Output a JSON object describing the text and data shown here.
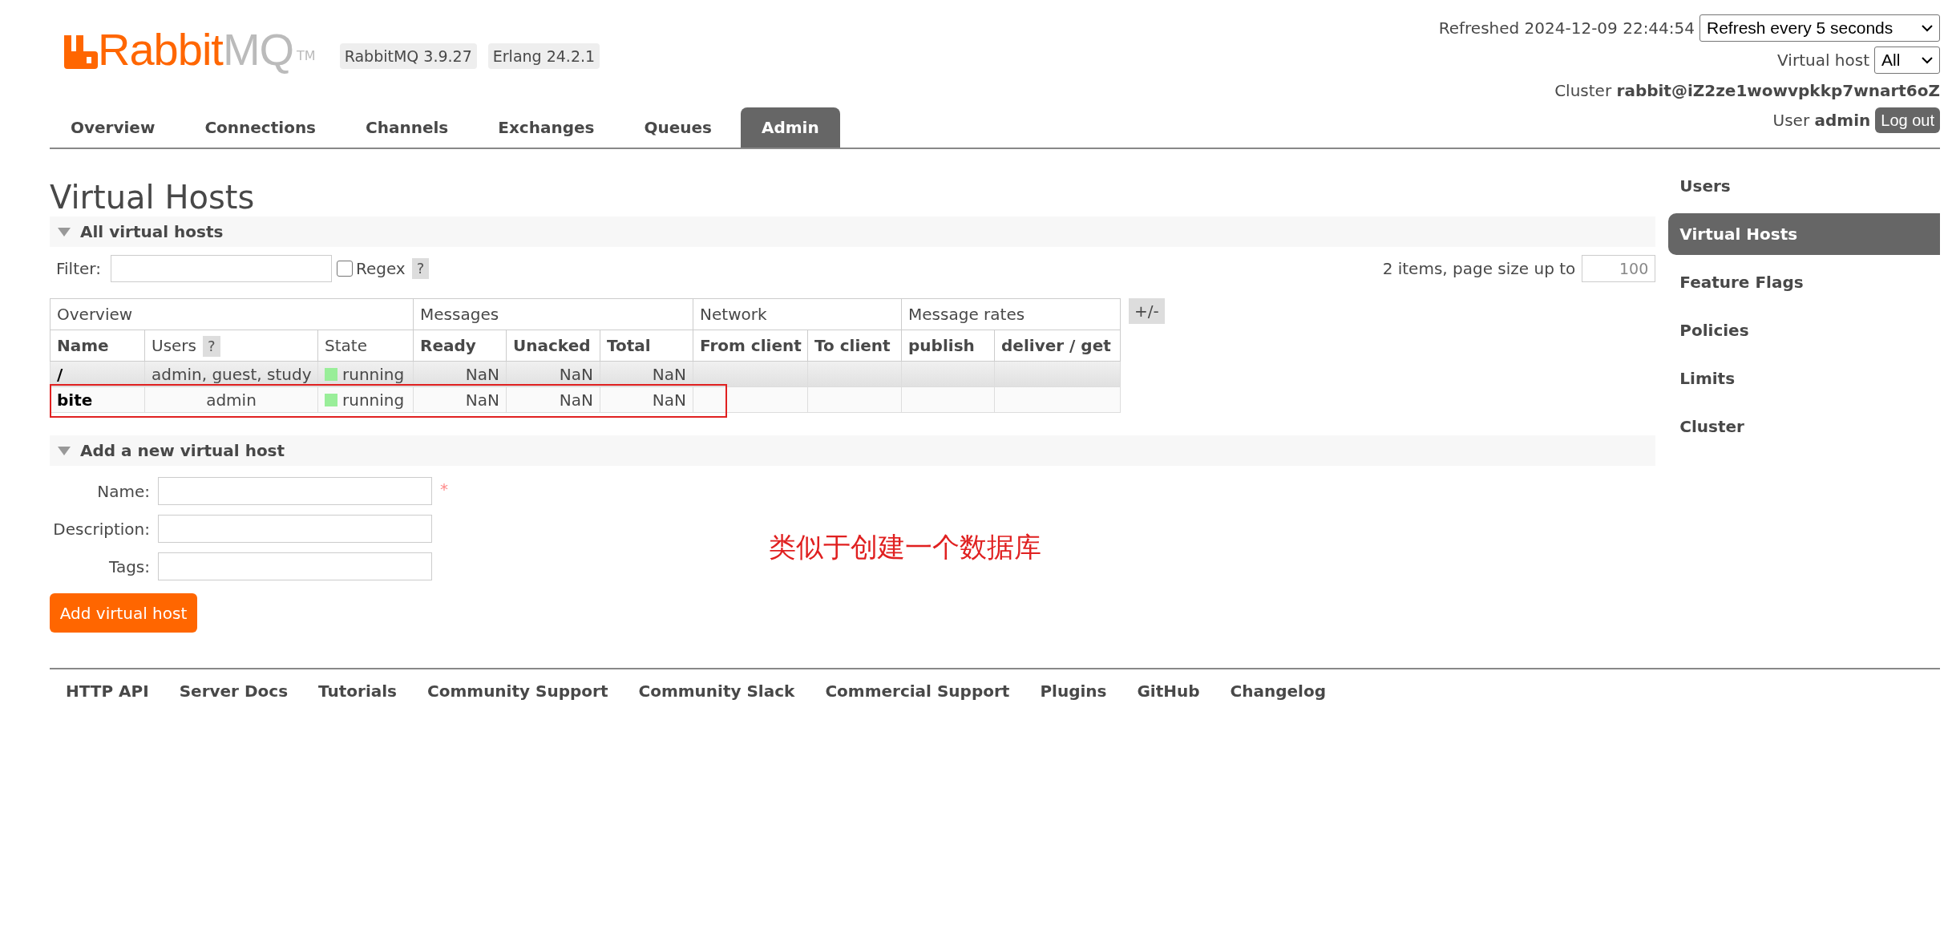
{
  "logo": {
    "brand_main": "Rabbit",
    "brand_accent": "MQ",
    "trademark": "TM"
  },
  "versions": [
    "RabbitMQ 3.9.27",
    "Erlang 24.2.1"
  ],
  "tabs": [
    {
      "label": "Overview",
      "selected": false
    },
    {
      "label": "Connections",
      "selected": false
    },
    {
      "label": "Channels",
      "selected": false
    },
    {
      "label": "Exchanges",
      "selected": false
    },
    {
      "label": "Queues",
      "selected": false
    },
    {
      "label": "Admin",
      "selected": true
    }
  ],
  "status": {
    "refreshed_label": "Refreshed 2024-12-09 22:44:54",
    "refresh_select": "Refresh every 5 seconds",
    "vhost_label": "Virtual host",
    "vhost_select": "All",
    "cluster_label": "Cluster",
    "cluster_name": "rabbit@iZ2ze1wowvpkkp7wnart6oZ",
    "user_label": "User",
    "user_name": "admin",
    "logout": "Log out"
  },
  "page_title": "Virtual Hosts",
  "all_section": {
    "title": "All virtual hosts",
    "filter_label": "Filter:",
    "regex_label": "Regex",
    "regex_checked": false,
    "help": "?",
    "count_text": "2 items, page size up to",
    "page_size": "100"
  },
  "table": {
    "groups": [
      {
        "label": "Overview"
      },
      {
        "label": "Messages"
      },
      {
        "label": "Network"
      },
      {
        "label": "Message rates"
      }
    ],
    "columns": [
      {
        "label": "Name",
        "help": false
      },
      {
        "label": "Users",
        "help": true
      },
      {
        "label": "State",
        "help": false
      },
      {
        "label": "Ready",
        "help": false
      },
      {
        "label": "Unacked",
        "help": false
      },
      {
        "label": "Total",
        "help": false
      },
      {
        "label": "From client",
        "help": false
      },
      {
        "label": "To client",
        "help": false
      },
      {
        "label": "publish",
        "help": false
      },
      {
        "label": "deliver / get",
        "help": false
      }
    ],
    "help": "?",
    "toggle": "+/-",
    "rows": [
      {
        "name": "/",
        "users": "admin, guest, study",
        "state": "running",
        "ready": "NaN",
        "unacked": "NaN",
        "total": "NaN",
        "highlighted": false
      },
      {
        "name": "bite",
        "users": "admin",
        "state": "running",
        "ready": "NaN",
        "unacked": "NaN",
        "total": "NaN",
        "highlighted": true
      }
    ]
  },
  "add_section": {
    "title": "Add a new virtual host",
    "fields": [
      {
        "label": "Name:",
        "required": true
      },
      {
        "label": "Description:",
        "required": false
      },
      {
        "label": "Tags:",
        "required": false
      }
    ],
    "required_mark": "*",
    "button": "Add virtual host"
  },
  "annotation": "类似于创建一个数据库",
  "sidebar": {
    "items": [
      {
        "label": "Users",
        "selected": false
      },
      {
        "label": "Virtual Hosts",
        "selected": true
      },
      {
        "label": "Feature Flags",
        "selected": false
      },
      {
        "label": "Policies",
        "selected": false
      },
      {
        "label": "Limits",
        "selected": false
      },
      {
        "label": "Cluster",
        "selected": false
      }
    ]
  },
  "footer": [
    "HTTP API",
    "Server Docs",
    "Tutorials",
    "Community Support",
    "Community Slack",
    "Commercial Support",
    "Plugins",
    "GitHub",
    "Changelog"
  ]
}
